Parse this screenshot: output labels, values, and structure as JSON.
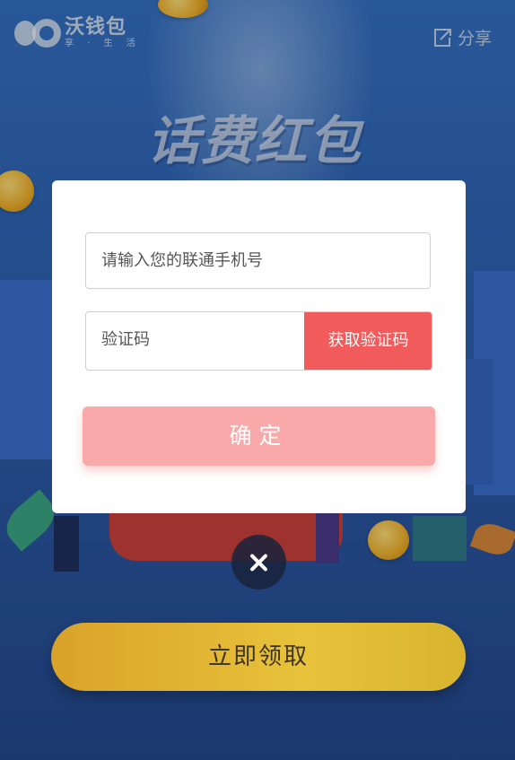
{
  "header": {
    "logo_name": "沃钱包",
    "logo_sub": "享 · 生 活",
    "share_label": "分享"
  },
  "banner": {
    "title": "话费红包"
  },
  "form": {
    "phone_placeholder": "请输入您的联通手机号",
    "code_placeholder": "验证码",
    "get_code_label": "获取验证码",
    "confirm_label": "确定"
  },
  "footer": {
    "claim_label": "立即领取"
  },
  "colors": {
    "accent_red": "#f15b5b",
    "confirm_pink": "#f9a9a9",
    "background_blue": "#2d5fae",
    "claim_gold": "#e8c23a"
  },
  "icons": {
    "close": "close-icon",
    "share": "share-icon"
  }
}
